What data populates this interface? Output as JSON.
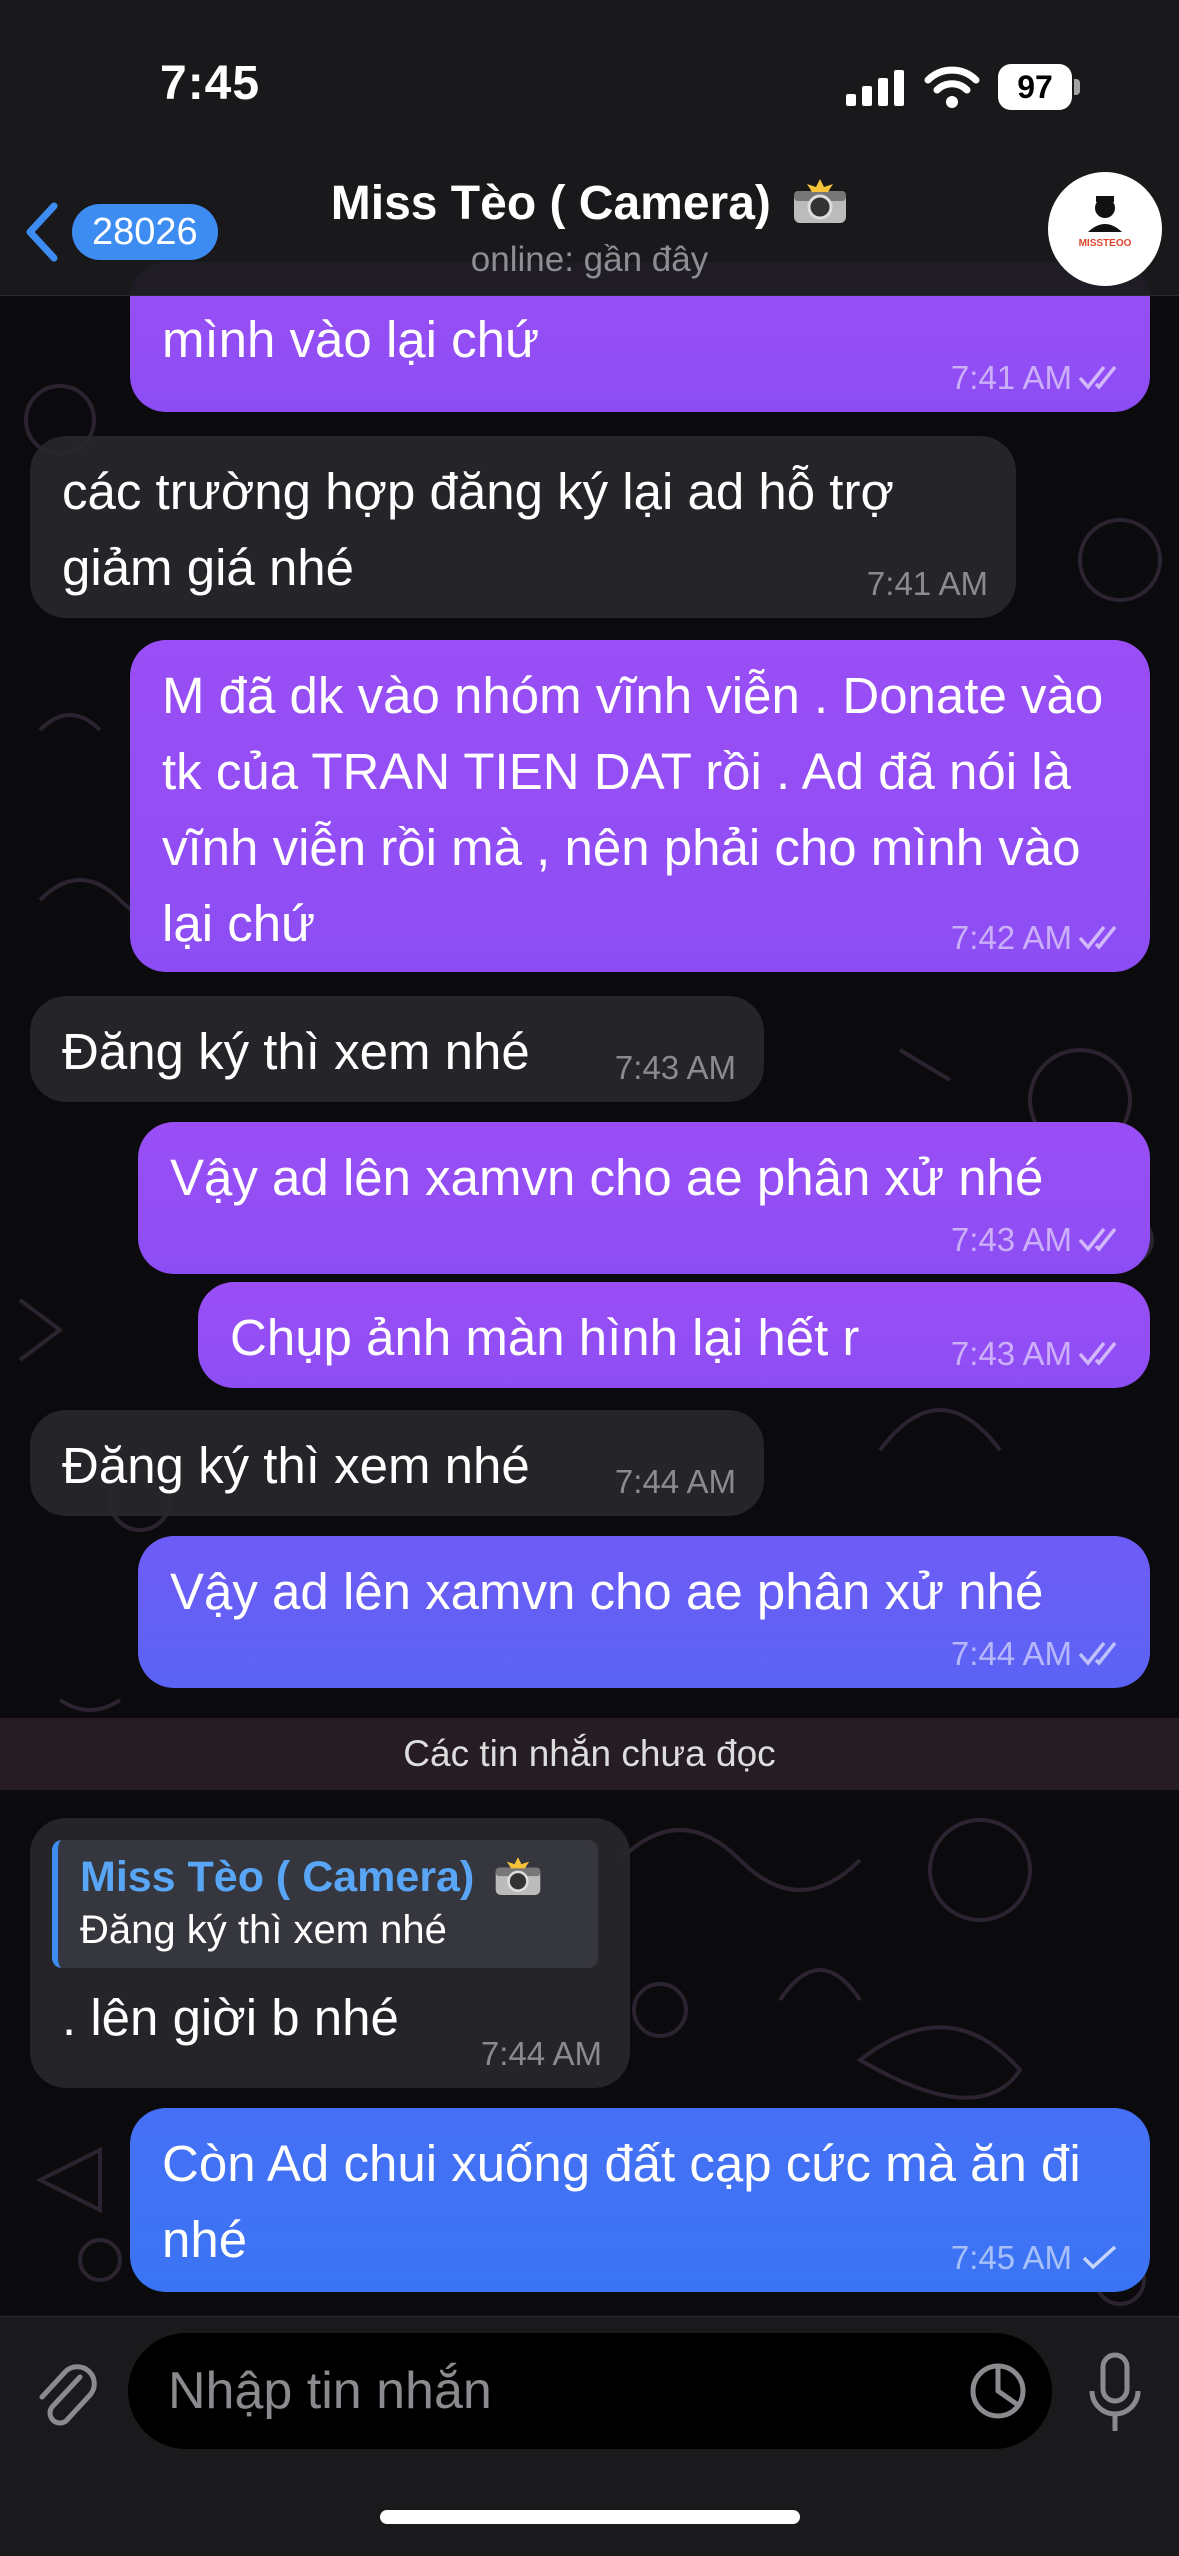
{
  "status_bar": {
    "time": "7:45",
    "battery": "97"
  },
  "header": {
    "back_count": "28026",
    "title": "Miss Tèo ( Camera)",
    "subtitle": "online: gần đây",
    "avatar_text": "MISSTEOO"
  },
  "messages": [
    {
      "dir": "out",
      "text": "mình vào lại chứ",
      "time": "7:41 AM",
      "ticks": "double"
    },
    {
      "dir": "in",
      "text": "các trường hợp đăng ký lại ad hỗ trợ giảm giá nhé",
      "time": "7:41 AM"
    },
    {
      "dir": "out",
      "text": "M đã dk vào nhóm vĩnh viễn . Donate vào tk của TRAN TIEN DAT rồi . Ad đã nói là vĩnh viễn rồi mà , nên phải cho mình vào lại chứ",
      "time": "7:42 AM",
      "ticks": "double"
    },
    {
      "dir": "in",
      "text": "Đăng ký thì xem nhé",
      "time": "7:43 AM"
    },
    {
      "dir": "out",
      "text": "Vậy ad lên xamvn cho ae phân xử nhé",
      "time": "7:43 AM",
      "ticks": "double"
    },
    {
      "dir": "out",
      "text": "Chụp ảnh màn hình lại hết r",
      "time": "7:43 AM",
      "ticks": "double"
    },
    {
      "dir": "in",
      "text": "Đăng ký thì xem nhé",
      "time": "7:44 AM"
    },
    {
      "dir": "out",
      "text": "Vậy ad lên xamvn cho ae phân xử nhé",
      "time": "7:44 AM",
      "ticks": "double"
    },
    {
      "dir": "in",
      "reply_to_name": "Miss Tèo ( Camera)",
      "reply_to_text": "Đăng ký thì xem nhé",
      "text": ". lên giời b nhé",
      "time": "7:44 AM"
    },
    {
      "dir": "out",
      "text": "Còn Ad chui xuống đất cạp cức mà ăn đi nhé",
      "time": "7:45 AM",
      "ticks": "single"
    }
  ],
  "unread_divider": "Các tin nhắn chưa đọc",
  "composer": {
    "placeholder": "Nhập tin nhắn"
  },
  "colors": {
    "accent": "#3d8cf2",
    "outgoing": "#8c4ef4",
    "incoming": "#28282c"
  }
}
